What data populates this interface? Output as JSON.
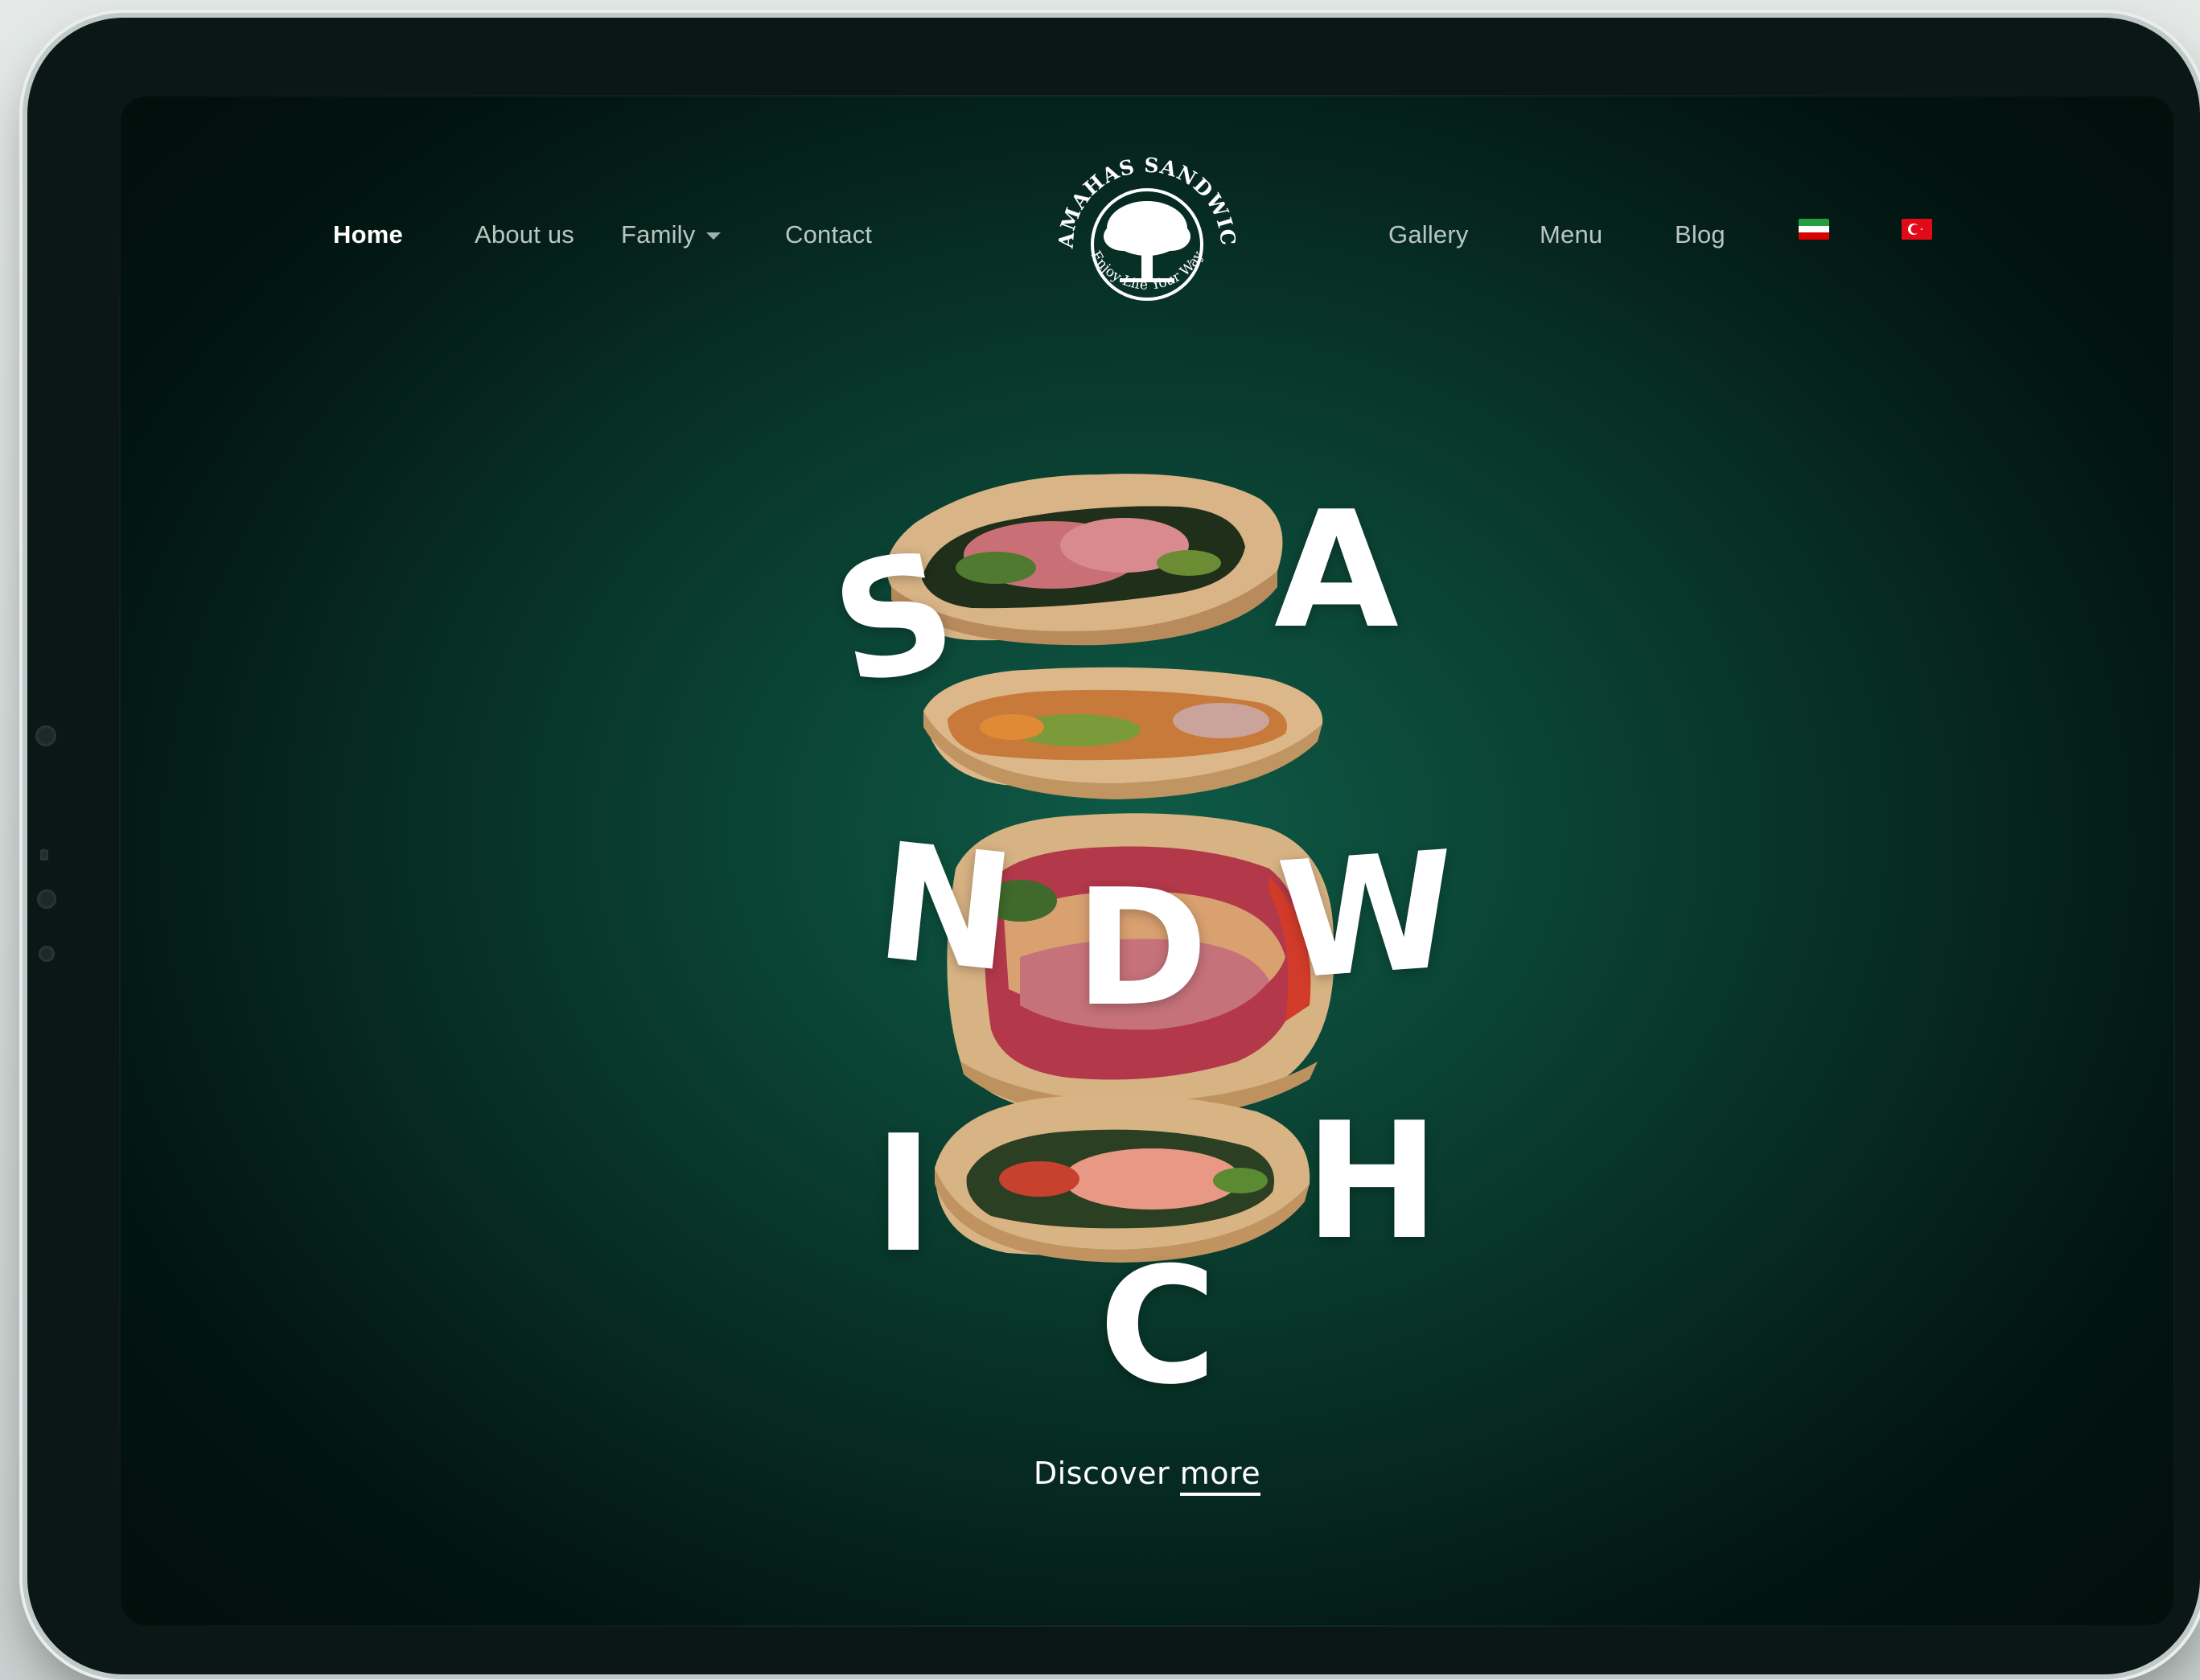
{
  "nav": {
    "left_items": [
      {
        "label": "Home",
        "active": true
      },
      {
        "label": "About us"
      },
      {
        "label": "Family",
        "has_dropdown": true
      },
      {
        "label": "Contact"
      }
    ],
    "right_items": [
      {
        "label": "Gallery"
      },
      {
        "label": "Menu"
      },
      {
        "label": "Blog"
      }
    ],
    "flags": [
      {
        "name": "iran-flag-icon",
        "colors": [
          "#239f40",
          "#ffffff",
          "#da0000"
        ]
      },
      {
        "name": "turkey-flag-icon",
        "colors": [
          "#e30a17",
          "#ffffff"
        ]
      }
    ]
  },
  "logo": {
    "brand_top": "BAMAHAS SANDWICH",
    "tagline": "Enjoy Life Your Way",
    "icon": "tree-icon"
  },
  "hero": {
    "letters": [
      "S",
      "A",
      "N",
      "D",
      "W",
      "I",
      "H",
      "C"
    ],
    "discover_prefix": "Discover ",
    "discover_link": "more"
  },
  "colors": {
    "background": "#0a4031",
    "text": "#ffffff",
    "nav_text": "#b9c6c2"
  }
}
